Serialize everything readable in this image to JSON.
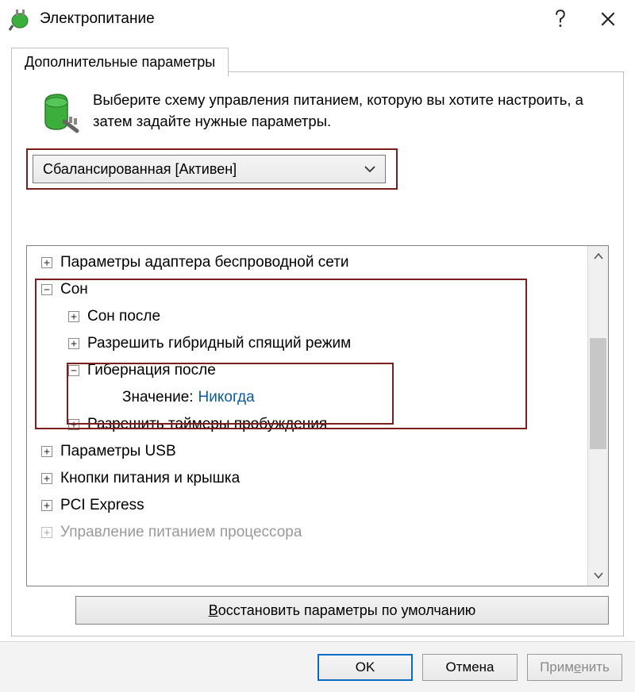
{
  "titlebar": {
    "title": "Электропитание"
  },
  "tab": {
    "label": "Дополнительные параметры"
  },
  "intro": {
    "text": "Выберите схему управления питанием, которую вы хотите настроить, а затем задайте нужные параметры."
  },
  "scheme_combo": {
    "selected": "Сбалансированная [Активен]"
  },
  "tree": {
    "wireless": "Параметры адаптера беспроводной сети",
    "sleep": "Сон",
    "sleep_after": "Сон после",
    "hybrid": "Разрешить гибридный спящий режим",
    "hibernate": "Гибернация после",
    "hibernate_value_label": "Значение:",
    "hibernate_value": "Никогда",
    "wake_timers": "Разрешить таймеры пробуждения",
    "usb": "Параметры USB",
    "buttons_lid": "Кнопки питания и крышка",
    "pci": "PCI Express",
    "cpu": "Управление питанием процессора"
  },
  "restore": {
    "prefix": "В",
    "rest": "осстановить параметры по умолчанию"
  },
  "footer": {
    "ok": "OK",
    "cancel": "Отмена",
    "apply_prefix": "Прим",
    "apply_ul": "е",
    "apply_rest": "нить"
  }
}
